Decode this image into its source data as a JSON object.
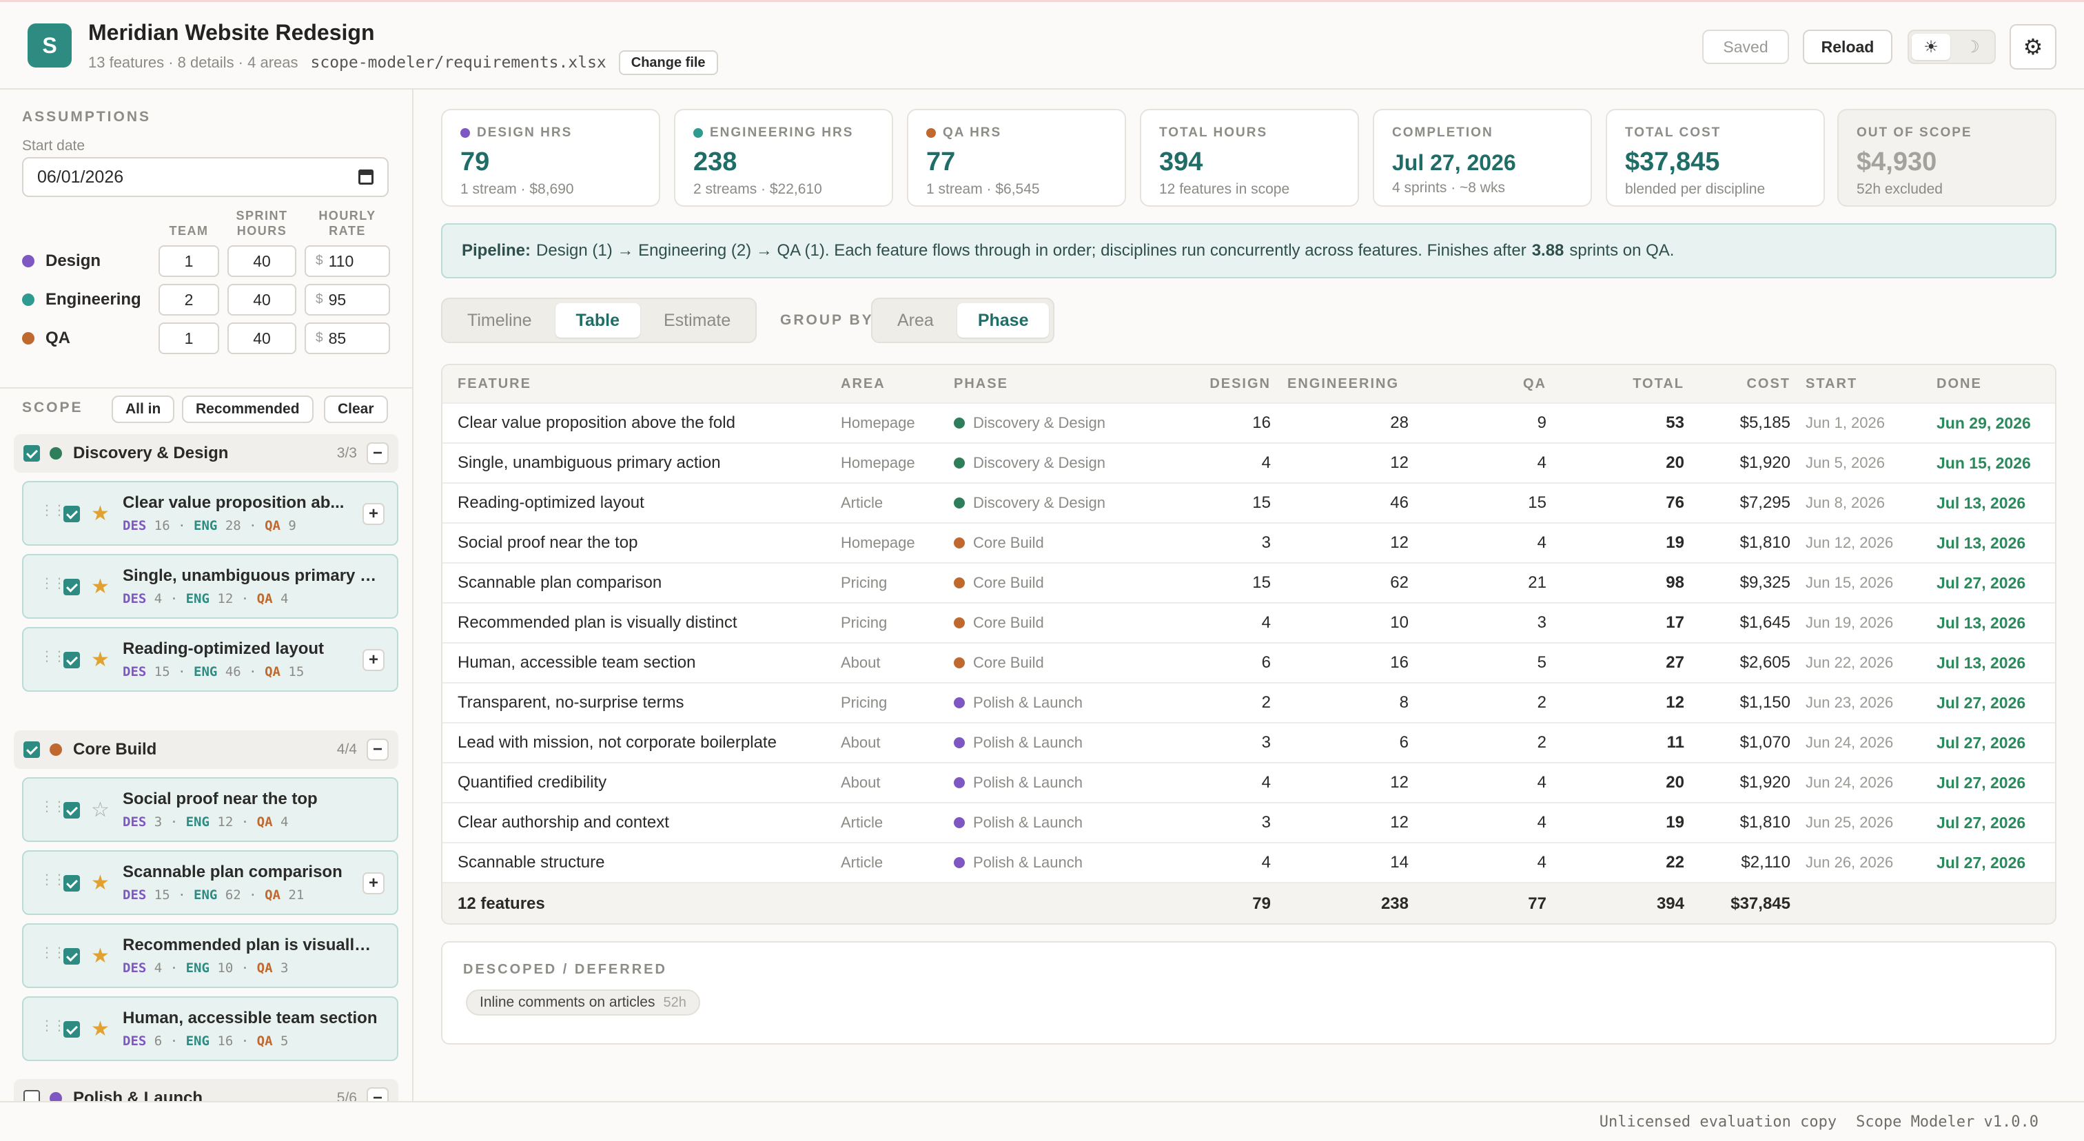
{
  "header": {
    "logo_letter": "S",
    "title": "Meridian Website Redesign",
    "summary": "13 features · 8 details · 4 areas",
    "file_path": "scope-modeler/requirements.xlsx",
    "change_file_label": "Change file",
    "saved_label": "Saved",
    "reload_label": "Reload",
    "theme_light_icon": "☀",
    "theme_dark_icon": "☽",
    "gear_icon": "⚙"
  },
  "assumptions": {
    "section_label": "ASSUMPTIONS",
    "start_date_label": "Start date",
    "start_date_value": "06/01/2026",
    "col_team": "TEAM",
    "col_sprint_hours_1": "SPRINT",
    "col_sprint_hours_2": "HOURS",
    "col_hourly_rate_1": "HOURLY",
    "col_hourly_rate_2": "RATE",
    "currency": "$",
    "disciplines": [
      {
        "name": "Design",
        "color": "#7e57c2",
        "team": "1",
        "sprint_hours": "40",
        "rate": "110"
      },
      {
        "name": "Engineering",
        "color": "#2e9a90",
        "team": "2",
        "sprint_hours": "40",
        "rate": "95"
      },
      {
        "name": "QA",
        "color": "#c0692e",
        "team": "1",
        "sprint_hours": "40",
        "rate": "85"
      }
    ]
  },
  "scope": {
    "section_label": "SCOPE",
    "all_in_label": "All in",
    "recommended_label": "Recommended",
    "clear_label": "Clear",
    "groups": [
      {
        "name": "Discovery & Design",
        "count": "3/3",
        "color": "#2e7d5b",
        "checked": true
      },
      {
        "name": "Core Build",
        "count": "4/4",
        "color": "#c0692e",
        "checked": true
      },
      {
        "name": "Polish & Launch",
        "count": "5/6",
        "color": "#7e57c2",
        "checked": false
      }
    ],
    "collapse_icon": "−",
    "expand_icon": "+",
    "des_label": "DES",
    "eng_label": "ENG",
    "qa_label": "QA",
    "sep": "·",
    "features": [
      {
        "name": "Clear value proposition ab...",
        "des": "16",
        "eng": "28",
        "qa": "9",
        "star": "★"
      },
      {
        "name": "Single, unambiguous primary a...",
        "des": "4",
        "eng": "12",
        "qa": "4",
        "star": "★"
      },
      {
        "name": "Reading-optimized layout",
        "des": "15",
        "eng": "46",
        "qa": "15",
        "star": "★"
      },
      {
        "name": "Social proof near the top",
        "des": "3",
        "eng": "12",
        "qa": "4",
        "star": "☆"
      },
      {
        "name": "Scannable plan comparison",
        "des": "15",
        "eng": "62",
        "qa": "21",
        "star": "★"
      },
      {
        "name": "Recommended plan is visually ...",
        "des": "4",
        "eng": "10",
        "qa": "3",
        "star": "★"
      },
      {
        "name": "Human, accessible team section",
        "des": "6",
        "eng": "16",
        "qa": "5",
        "star": "★"
      }
    ]
  },
  "stats": [
    {
      "label": "DESIGN HRS",
      "value": "79",
      "sub": "1 stream · $8,690",
      "dot": "#7e57c2"
    },
    {
      "label": "ENGINEERING HRS",
      "value": "238",
      "sub": "2 streams · $22,610",
      "dot": "#2e9a90"
    },
    {
      "label": "QA HRS",
      "value": "77",
      "sub": "1 stream · $6,545",
      "dot": "#c0692e"
    },
    {
      "label": "TOTAL HOURS",
      "value": "394",
      "sub": "12 features in scope"
    },
    {
      "label": "COMPLETION",
      "value": "Jul 27, 2026",
      "sub": "4 sprints · ~8 wks"
    },
    {
      "label": "TOTAL COST",
      "value": "$37,845",
      "sub": "blended per discipline"
    },
    {
      "label": "OUT OF SCOPE",
      "value": "$4,930",
      "sub": "52h excluded"
    }
  ],
  "pipeline": {
    "label": "Pipeline:",
    "text_before": "Design (1) → Engineering (2) → QA (1). Each feature flows through in order; disciplines run concurrently across features. Finishes after",
    "sprints": "3.88",
    "text_after": "sprints on QA."
  },
  "view_tabs": [
    "Timeline",
    "Table",
    "Estimate"
  ],
  "group_by_label": "GROUP BY",
  "group_tabs": [
    "Area",
    "Phase"
  ],
  "table": {
    "columns": [
      "FEATURE",
      "AREA",
      "PHASE",
      "DESIGN",
      "ENGINEERING",
      "QA",
      "TOTAL",
      "COST",
      "START",
      "DONE"
    ],
    "rows": [
      {
        "feature": "Clear value proposition above the fold",
        "area": "Homepage",
        "phase": "Discovery & Design",
        "phase_color": "#2e7d5b",
        "design": "16",
        "eng": "28",
        "qa": "9",
        "total": "53",
        "cost": "$5,185",
        "start": "Jun 1, 2026",
        "done": "Jun 29, 2026"
      },
      {
        "feature": "Single, unambiguous primary action",
        "area": "Homepage",
        "phase": "Discovery & Design",
        "phase_color": "#2e7d5b",
        "design": "4",
        "eng": "12",
        "qa": "4",
        "total": "20",
        "cost": "$1,920",
        "start": "Jun 5, 2026",
        "done": "Jun 15, 2026"
      },
      {
        "feature": "Reading-optimized layout",
        "area": "Article",
        "phase": "Discovery & Design",
        "phase_color": "#2e7d5b",
        "design": "15",
        "eng": "46",
        "qa": "15",
        "total": "76",
        "cost": "$7,295",
        "start": "Jun 8, 2026",
        "done": "Jul 13, 2026"
      },
      {
        "feature": "Social proof near the top",
        "area": "Homepage",
        "phase": "Core Build",
        "phase_color": "#c0692e",
        "design": "3",
        "eng": "12",
        "qa": "4",
        "total": "19",
        "cost": "$1,810",
        "start": "Jun 12, 2026",
        "done": "Jul 13, 2026"
      },
      {
        "feature": "Scannable plan comparison",
        "area": "Pricing",
        "phase": "Core Build",
        "phase_color": "#c0692e",
        "design": "15",
        "eng": "62",
        "qa": "21",
        "total": "98",
        "cost": "$9,325",
        "start": "Jun 15, 2026",
        "done": "Jul 27, 2026"
      },
      {
        "feature": "Recommended plan is visually distinct",
        "area": "Pricing",
        "phase": "Core Build",
        "phase_color": "#c0692e",
        "design": "4",
        "eng": "10",
        "qa": "3",
        "total": "17",
        "cost": "$1,645",
        "start": "Jun 19, 2026",
        "done": "Jul 13, 2026"
      },
      {
        "feature": "Human, accessible team section",
        "area": "About",
        "phase": "Core Build",
        "phase_color": "#c0692e",
        "design": "6",
        "eng": "16",
        "qa": "5",
        "total": "27",
        "cost": "$2,605",
        "start": "Jun 22, 2026",
        "done": "Jul 13, 2026"
      },
      {
        "feature": "Transparent, no-surprise terms",
        "area": "Pricing",
        "phase": "Polish & Launch",
        "phase_color": "#7e57c2",
        "design": "2",
        "eng": "8",
        "qa": "2",
        "total": "12",
        "cost": "$1,150",
        "start": "Jun 23, 2026",
        "done": "Jul 27, 2026"
      },
      {
        "feature": "Lead with mission, not corporate boilerplate",
        "area": "About",
        "phase": "Polish & Launch",
        "phase_color": "#7e57c2",
        "design": "3",
        "eng": "6",
        "qa": "2",
        "total": "11",
        "cost": "$1,070",
        "start": "Jun 24, 2026",
        "done": "Jul 27, 2026"
      },
      {
        "feature": "Quantified credibility",
        "area": "About",
        "phase": "Polish & Launch",
        "phase_color": "#7e57c2",
        "design": "4",
        "eng": "12",
        "qa": "4",
        "total": "20",
        "cost": "$1,920",
        "start": "Jun 24, 2026",
        "done": "Jul 27, 2026"
      },
      {
        "feature": "Clear authorship and context",
        "area": "Article",
        "phase": "Polish & Launch",
        "phase_color": "#7e57c2",
        "design": "3",
        "eng": "12",
        "qa": "4",
        "total": "19",
        "cost": "$1,810",
        "start": "Jun 25, 2026",
        "done": "Jul 27, 2026"
      },
      {
        "feature": "Scannable structure",
        "area": "Article",
        "phase": "Polish & Launch",
        "phase_color": "#7e57c2",
        "design": "4",
        "eng": "14",
        "qa": "4",
        "total": "22",
        "cost": "$2,110",
        "start": "Jun 26, 2026",
        "done": "Jul 27, 2026"
      }
    ],
    "footer": {
      "label": "12 features",
      "design": "79",
      "eng": "238",
      "qa": "77",
      "total": "394",
      "cost": "$37,845"
    }
  },
  "descoped": {
    "label": "DESCOPED / DEFERRED",
    "items": [
      {
        "name": "Inline comments on articles",
        "hours": "52h"
      }
    ]
  },
  "footer": {
    "license": "Unlicensed evaluation copy",
    "version": "Scope Modeler v1.0.0"
  }
}
